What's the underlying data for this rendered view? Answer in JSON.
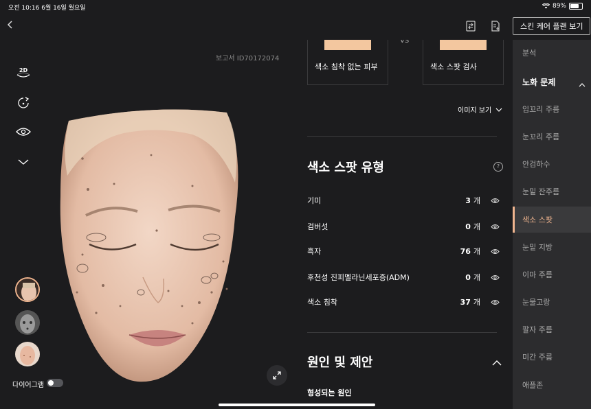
{
  "status": {
    "time": "오전 10:16 6월 16일 월요일",
    "battery": "89%",
    "battery_level": 0.89
  },
  "nav": {
    "back_icon": "chevron-left-icon",
    "plan_button": "스킨 케어 플랜 보기"
  },
  "left": {
    "report_id": "보고서 ID70172074",
    "tools": {
      "view_2d": "2D"
    },
    "diagram_label": "다이어그램"
  },
  "compare": {
    "card_a": "색소 침착 없는 피부",
    "vs": "VS",
    "card_b": "색소 스팟 검사"
  },
  "image_view": "이미지 보기",
  "section": {
    "title": "색소 스팟 유형",
    "rows": [
      {
        "name": "기미",
        "count": "3",
        "unit": "개"
      },
      {
        "name": "검버섯",
        "count": "0",
        "unit": "개"
      },
      {
        "name": "흑자",
        "count": "76",
        "unit": "개"
      },
      {
        "name": "후천성 진피멜라닌세포증(ADM)",
        "count": "0",
        "unit": "개"
      },
      {
        "name": "색소 침착",
        "count": "37",
        "unit": "개"
      }
    ]
  },
  "cause": {
    "title": "원인 및 제안",
    "subtitle": "형성되는 원인"
  },
  "sidebar": {
    "items": [
      "분석",
      "노화 문제",
      "입꼬리 주름",
      "눈꼬리 주름",
      "안검하수",
      "눈밑 잔주름",
      "색소 스팟",
      "눈밑 지방",
      "이마 주름",
      "눈물고랑",
      "팔자 주름",
      "미간 주름",
      "애플존"
    ]
  },
  "colors": {
    "accent": "#f0b58f",
    "background": "#1c1c1e",
    "sidebar": "#2c2c2e"
  }
}
